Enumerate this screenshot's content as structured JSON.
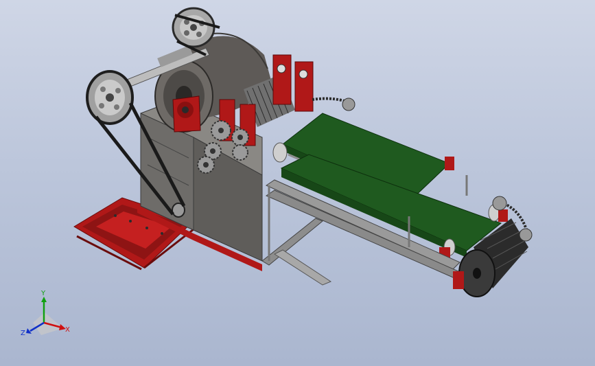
{
  "viewport": {
    "background_top": "#cfd6e6",
    "background_bottom": "#aab6cf"
  },
  "colors": {
    "frame_red": "#b01818",
    "belt_green": "#1f5a1f",
    "drum_gray": "#5e5a57",
    "steel": "#8d8d8d",
    "roller_dark": "#2b2b2b"
  },
  "triad": {
    "x_label": "X",
    "y_label": "Y",
    "z_label": "Z",
    "x_color": "#d01010",
    "y_color": "#10a010",
    "z_color": "#1030c8"
  }
}
